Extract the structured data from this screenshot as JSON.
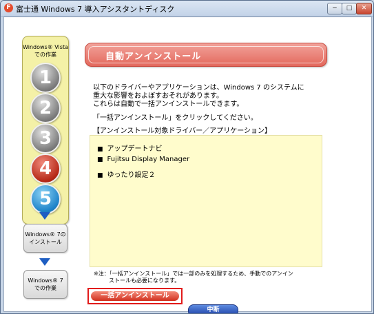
{
  "window": {
    "title": "富士通 Windows 7 導入アシスタントディスク",
    "icon": "fujitsu-app-icon",
    "controls": {
      "minimize": "─",
      "maximize": "□",
      "close": "✕"
    }
  },
  "sidebar": {
    "title_line1": "Windows® Vista",
    "title_line2": "での作業",
    "steps": [
      "1",
      "2",
      "3",
      "4",
      "5"
    ],
    "current_step": "4",
    "boxes": [
      {
        "label": "Windows® 7の\nインストール"
      },
      {
        "label": "Windows® 7\nでの作業"
      }
    ]
  },
  "main": {
    "header": "自動アンインストール",
    "paragraph": [
      "以下のドライバーやアプリケーションは、Windows 7 のシステムに",
      "重大な影響をおよぼすおそれがあります。",
      "これらは自動で一括アンインストールできます。"
    ],
    "instruction": "「一括アンインストール」をクリックしてください。",
    "list_title": "【アンインストール対象ドライバー／アプリケーション】",
    "items": [
      "アップデートナビ",
      "Fujitsu Display Manager",
      "ゆったり設定２"
    ],
    "bullet": "■",
    "note_line1": "※注：「一括アンインストール」では一部のみを処理するため、手動でのアンイン",
    "note_line2": "ストールも必要になります。",
    "uninstall_button": "一括アンインストール",
    "cancel_button": "中断"
  },
  "colors": {
    "header_red": "#e3685c",
    "step_current": "#b62817",
    "step_active_blue": "#1e83c9",
    "list_background": "#fffccc",
    "highlight_border": "#e21a1a"
  }
}
